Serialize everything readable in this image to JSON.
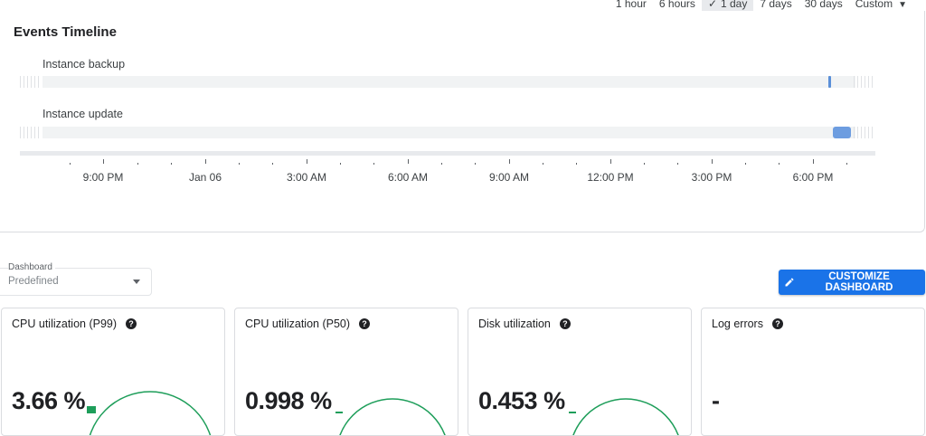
{
  "time_range": {
    "options": [
      "1 hour",
      "6 hours",
      "1 day",
      "7 days",
      "30 days",
      "Custom"
    ],
    "selected": "1 day"
  },
  "events": {
    "title": "Events Timeline",
    "rows": [
      {
        "label": "Instance backup"
      },
      {
        "label": "Instance update"
      }
    ],
    "axis_labels": [
      "9:00 PM",
      "Jan 06",
      "3:00 AM",
      "6:00 AM",
      "9:00 AM",
      "12:00 PM",
      "3:00 PM",
      "6:00 PM"
    ]
  },
  "dashboard": {
    "caption": "Dashboard",
    "value": "Predefined",
    "customize_label": "CUSTOMIZE DASHBOARD"
  },
  "metrics": [
    {
      "title": "CPU utilization (P99)",
      "value": "3.66 %",
      "gauge_fraction": 0.0366
    },
    {
      "title": "CPU utilization (P50)",
      "value": "0.998 %",
      "gauge_fraction": 0.00998
    },
    {
      "title": "Disk utilization",
      "value": "0.453 %",
      "gauge_fraction": 0.00453
    },
    {
      "title": "Log errors",
      "value": "-",
      "gauge_fraction": null
    }
  ],
  "colors": {
    "accent": "#1a73e8",
    "gauge": "#1e9e5a",
    "event_marker": "#5a8fd8"
  }
}
